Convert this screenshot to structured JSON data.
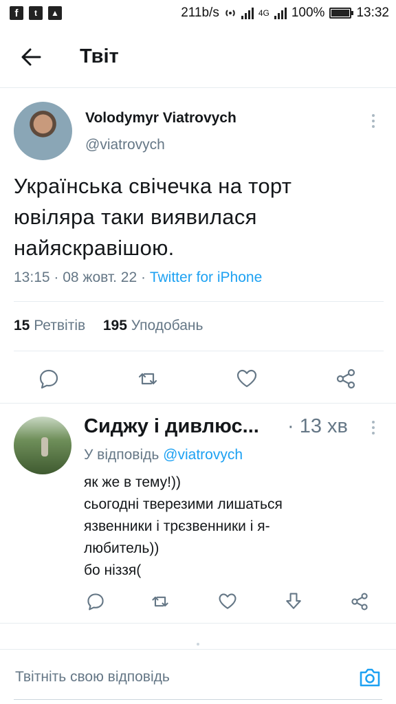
{
  "status_bar": {
    "app_icons": [
      "facebook-icon",
      "twitter-icon",
      "image-icon"
    ],
    "network_speed": "211b/s",
    "network_type": "4G",
    "battery": "100%",
    "time": "13:32"
  },
  "header": {
    "title": "Твіт"
  },
  "tweet": {
    "author_name": "Volodymyr Viatrovych",
    "author_handle": "@viatrovych",
    "text": "Українська свічечка на торт ювіляра таки виявилася найяскравішою.",
    "time": "13:15",
    "date": "08 жовт. 22",
    "source": "Twitter for iPhone",
    "retweets_count": "15",
    "retweets_label": "Ретвітів",
    "likes_count": "195",
    "likes_label": "Уподобань"
  },
  "reply": {
    "author_name": "Сиджу і дивлюс...",
    "time": "13 хв",
    "replying_prefix": "У відповідь",
    "replying_to": "@viatrovych",
    "lines": [
      "як же в тему!))",
      "сьогодні тверезими лишаться",
      "язвенники і трєзвенники і я-",
      "любитель))",
      "бо ніззя("
    ]
  },
  "compose": {
    "placeholder": "Твітніть свою відповідь"
  },
  "colors": {
    "accent": "#1da1f2",
    "secondary_text": "#657786",
    "divider": "#e6ecf0"
  }
}
